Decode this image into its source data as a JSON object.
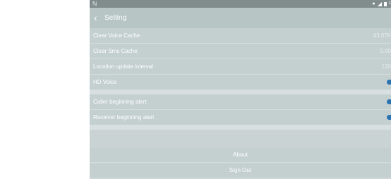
{
  "header": {
    "title": "Setting"
  },
  "rows": [
    {
      "label": "Clear Voice Cache",
      "value": "43.07K"
    },
    {
      "label": "Clear Sms Cache",
      "value": "0.00"
    },
    {
      "label": "Location update interval",
      "value": "120"
    },
    {
      "label": "HD Voice",
      "toggle": "on"
    },
    {
      "label": "Caller beginning alert",
      "toggle": "on"
    },
    {
      "label": "Receiver beginning alert",
      "toggle": "on"
    }
  ],
  "buttons": {
    "about": "About",
    "sign_out": "Sign Out"
  },
  "colors": {
    "toggle_on": "#2b73b0",
    "header": "#b7c5c5",
    "row": "#c4cfcf"
  },
  "icons": [
    "n-notification-icon",
    "location-icon",
    "signal-icon",
    "battery-icon",
    "back-arrow-icon"
  ]
}
